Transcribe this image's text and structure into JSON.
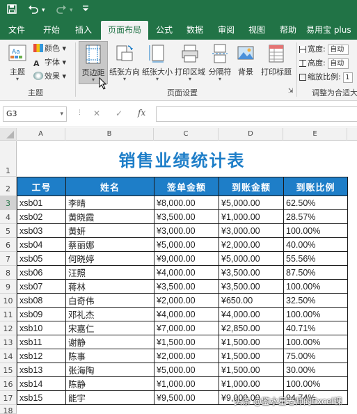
{
  "quick_access": {
    "save_icon": "save-icon",
    "undo_icon": "undo-icon",
    "redo_icon": "redo-icon",
    "customize_icon": "customize-icon"
  },
  "tabs": [
    {
      "label": "文件",
      "active": false
    },
    {
      "label": "开始",
      "active": false
    },
    {
      "label": "插入",
      "active": false
    },
    {
      "label": "页面布局",
      "active": true
    },
    {
      "label": "公式",
      "active": false
    },
    {
      "label": "数据",
      "active": false
    },
    {
      "label": "审阅",
      "active": false
    },
    {
      "label": "视图",
      "active": false
    },
    {
      "label": "帮助",
      "active": false
    },
    {
      "label": "易用宝 plus",
      "active": false
    }
  ],
  "ribbon": {
    "theme_group": {
      "label": "主题",
      "theme_btn": "主题",
      "colors": "颜色",
      "fonts": "字体",
      "effects": "效果"
    },
    "page_setup_group": {
      "label": "页面设置",
      "margins": "页边距",
      "orientation": "纸张方向",
      "size": "纸张大小",
      "print_area": "打印区域",
      "breaks": "分隔符",
      "background": "背景",
      "print_titles": "打印标题"
    },
    "scale_group": {
      "label": "调整为合适大",
      "width": "宽度:",
      "width_value": "自动",
      "height": "高度:",
      "height_value": "自动",
      "scale": "缩放比例:",
      "scale_value": "1"
    }
  },
  "formula_bar": {
    "name_box": "G3",
    "cancel": "✕",
    "enter": "✓",
    "fx": "fx",
    "formula": ""
  },
  "columns": [
    "A",
    "B",
    "C",
    "D",
    "E"
  ],
  "rows": [
    "1",
    "2",
    "3",
    "4",
    "5",
    "6",
    "7",
    "8",
    "9",
    "10",
    "11",
    "12",
    "13",
    "14",
    "15",
    "16",
    "17",
    "18"
  ],
  "sheet": {
    "title": "销售业绩统计表",
    "headers": [
      "工号",
      "姓名",
      "签单金额",
      "到账金额",
      "到账比例"
    ],
    "data": [
      [
        "xsb01",
        "李晴",
        "¥8,000.00",
        "¥5,000.00",
        "62.50%"
      ],
      [
        "xsb02",
        "黄晓霞",
        "¥3,500.00",
        "¥1,000.00",
        "28.57%"
      ],
      [
        "xsb03",
        "黄妍",
        "¥3,000.00",
        "¥3,000.00",
        "100.00%"
      ],
      [
        "xsb04",
        "蔡丽娜",
        "¥5,000.00",
        "¥2,000.00",
        "40.00%"
      ],
      [
        "xsb05",
        "何晓婷",
        "¥9,000.00",
        "¥5,000.00",
        "55.56%"
      ],
      [
        "xsb06",
        "汪照",
        "¥4,000.00",
        "¥3,500.00",
        "87.50%"
      ],
      [
        "xsb07",
        "蒋林",
        "¥3,500.00",
        "¥3,500.00",
        "100.00%"
      ],
      [
        "xsb08",
        "白奇伟",
        "¥2,000.00",
        "¥650.00",
        "32.50%"
      ],
      [
        "xsb09",
        "邓礼杰",
        "¥4,000.00",
        "¥4,000.00",
        "100.00%"
      ],
      [
        "xsb10",
        "宋嘉仁",
        "¥7,000.00",
        "¥2,850.00",
        "40.71%"
      ],
      [
        "xsb11",
        "谢静",
        "¥1,500.00",
        "¥1,500.00",
        "100.00%"
      ],
      [
        "xsb12",
        "陈事",
        "¥2,000.00",
        "¥1,500.00",
        "75.00%"
      ],
      [
        "xsb13",
        "张海陶",
        "¥5,000.00",
        "¥1,500.00",
        "30.00%"
      ],
      [
        "xsb14",
        "陈静",
        "¥1,000.00",
        "¥1,000.00",
        "100.00%"
      ],
      [
        "xsb15",
        "能宇",
        "¥9,500.00",
        "¥9,000.00",
        "94.74%"
      ]
    ]
  },
  "watermark": "头条 @鉴水星老师的Excel课",
  "colors": {
    "excel_green": "#217346",
    "header_blue": "#1e7ec8",
    "title_blue": "#1e7ec8"
  }
}
